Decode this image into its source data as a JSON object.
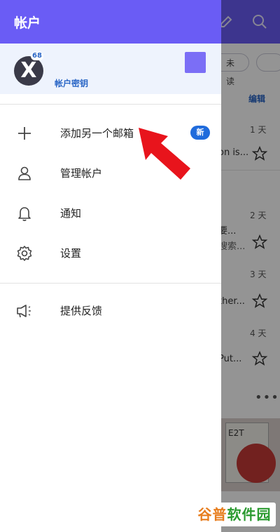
{
  "drawer": {
    "title": "帐户",
    "account": {
      "avatar_letter": "X",
      "unread_count": "68",
      "key_link": "帐户密钥",
      "swatch_color": "#7b6ef6"
    },
    "items": [
      {
        "label": "添加另一个邮箱",
        "icon": "plus-icon",
        "badge": "新"
      },
      {
        "label": "管理帐户",
        "icon": "person-icon"
      },
      {
        "label": "通知",
        "icon": "bell-icon"
      },
      {
        "label": "设置",
        "icon": "gear-icon"
      }
    ],
    "feedback": {
      "label": "提供反馈",
      "icon": "megaphone-icon"
    }
  },
  "background": {
    "header_icons": [
      "edit-icon",
      "search-icon"
    ],
    "chip_unread": "未读",
    "edit_label": "编辑",
    "emails": [
      {
        "days": "1 天",
        "snippet": "on is..."
      },
      {
        "days": "2 天",
        "snippet": "要...",
        "snippet2": "搜索..."
      },
      {
        "days": "3 天",
        "snippet": "ther..."
      },
      {
        "days": "4 天",
        "snippet": "Put..."
      }
    ],
    "more": "•••",
    "photo_text": "E2T"
  },
  "theme": {
    "accent": "#6a5cf5",
    "link": "#2a66c6",
    "badge": "#1f6bdc",
    "arrow": "#e8141c"
  },
  "watermark": {
    "part1": "谷普",
    "part2": "软件园"
  }
}
